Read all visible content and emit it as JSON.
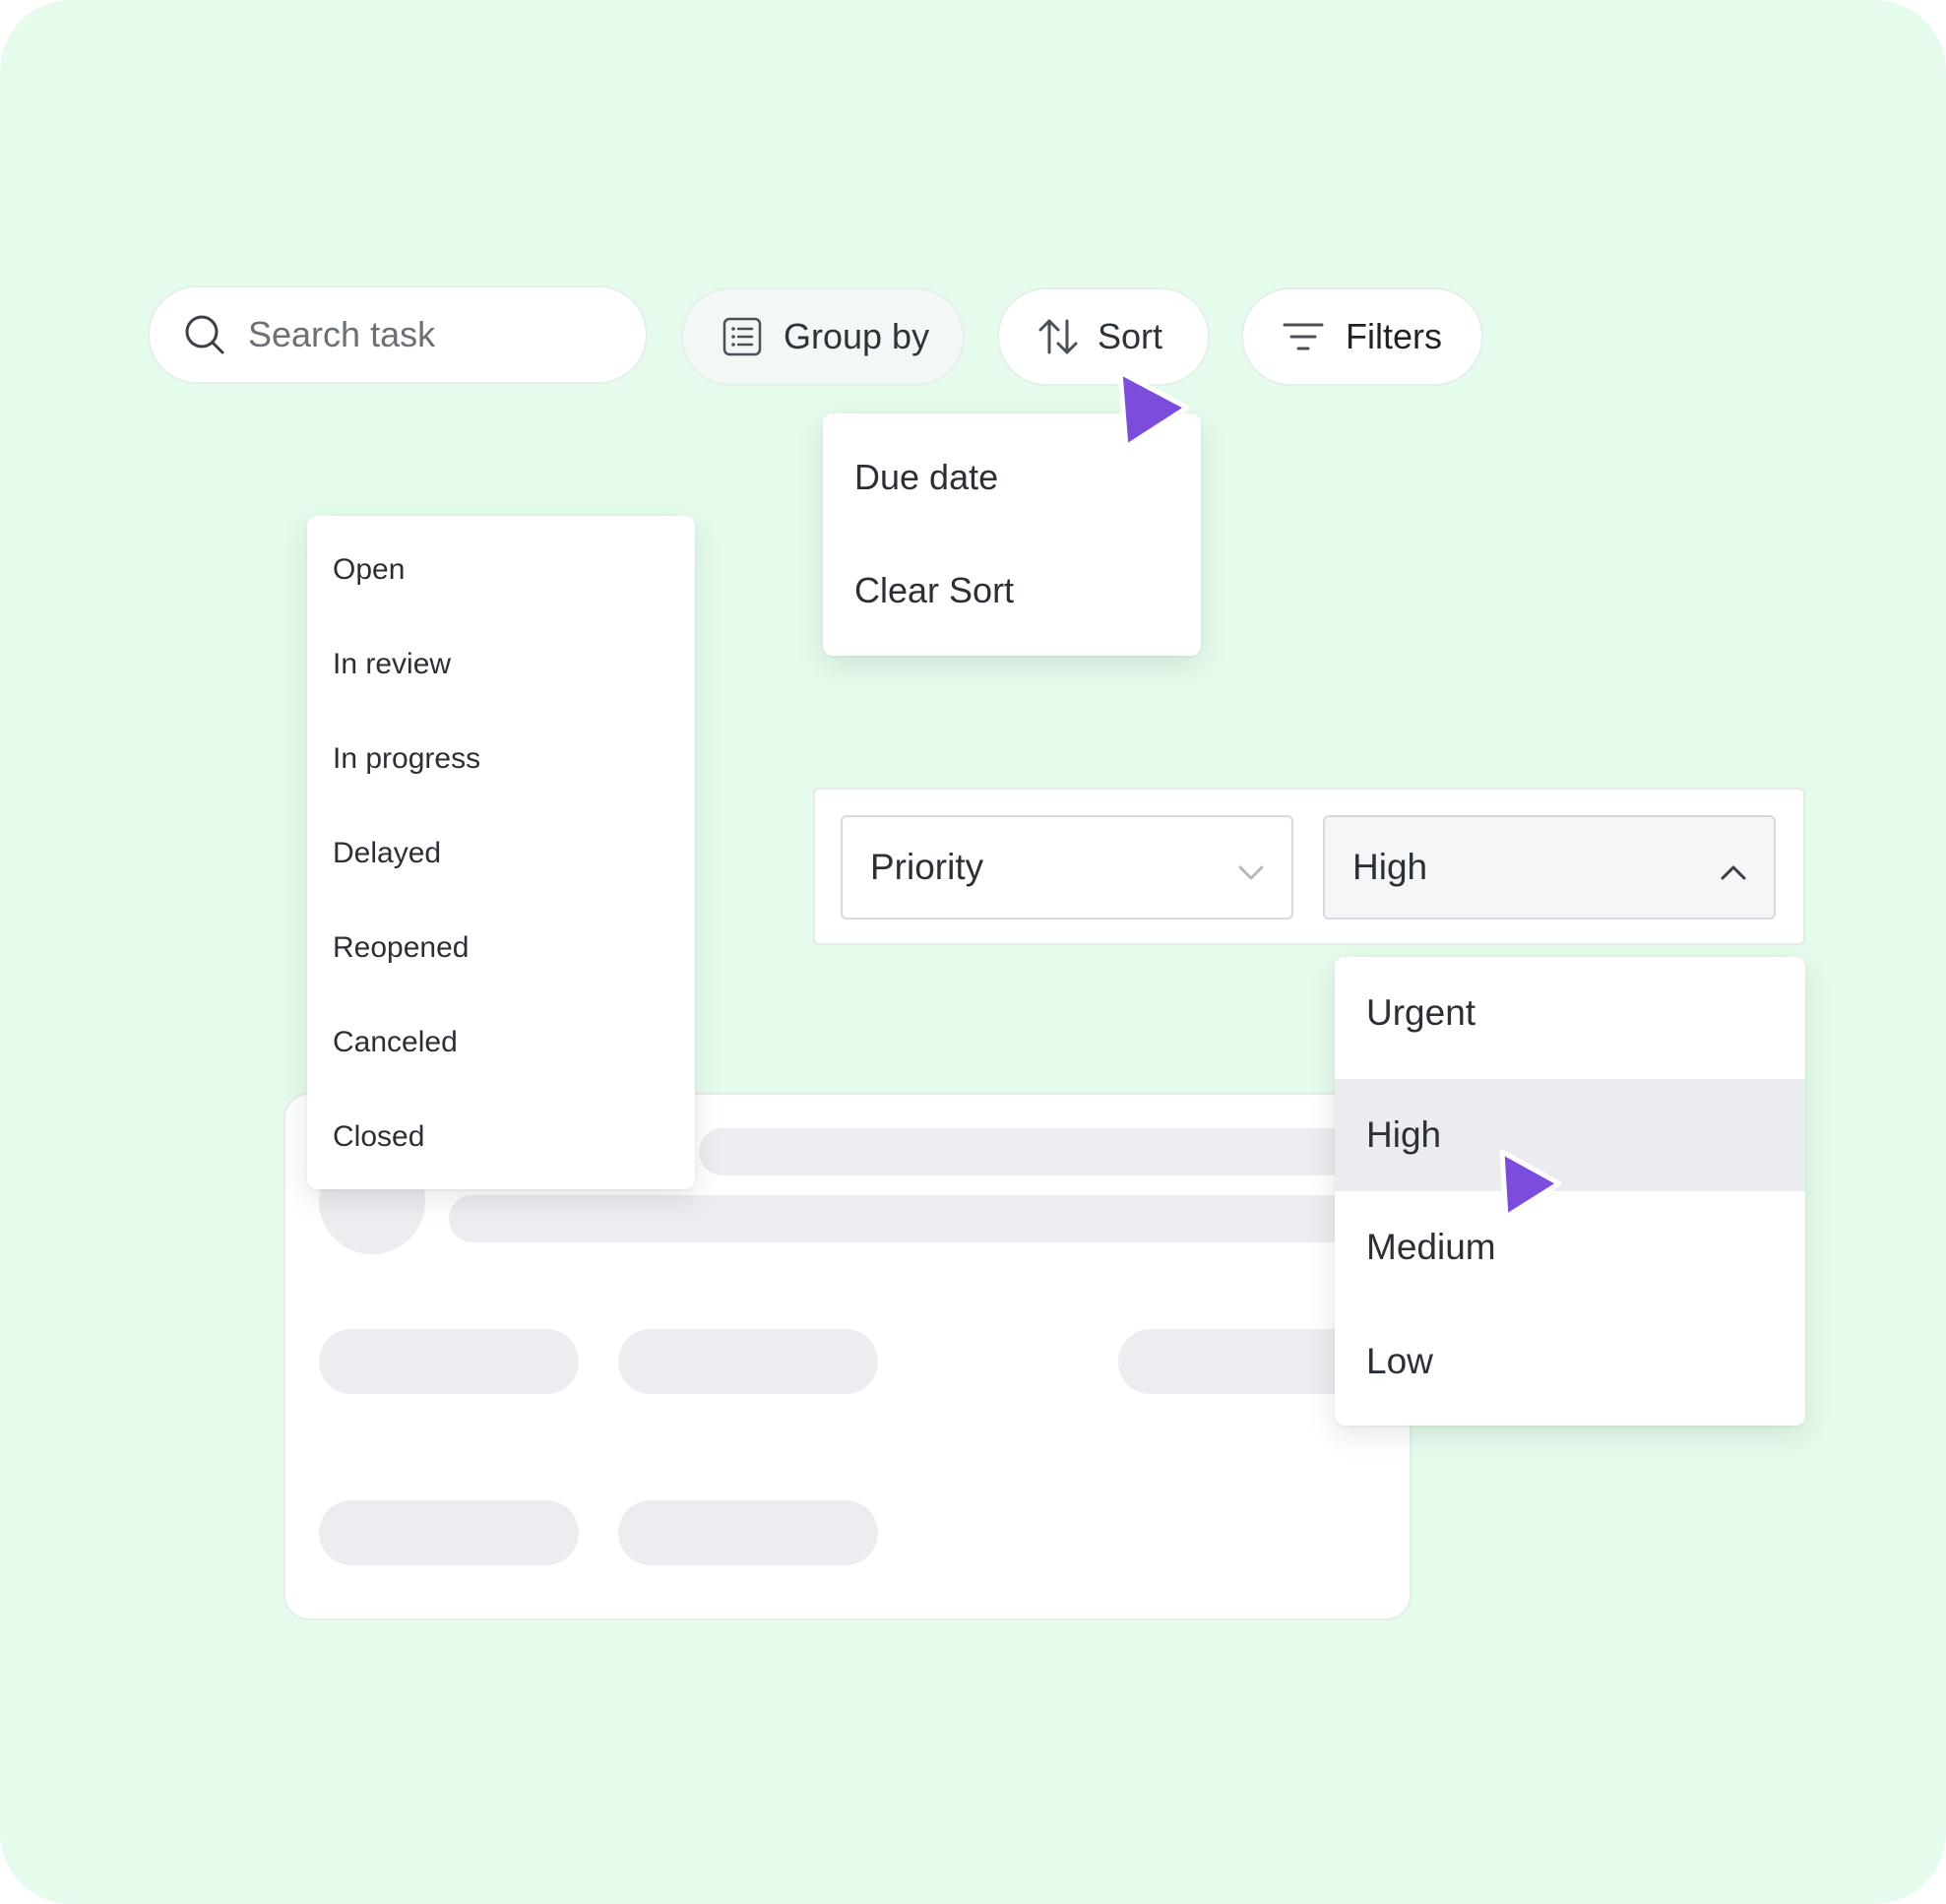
{
  "toolbar": {
    "search_placeholder": "Search task",
    "group_by_label": "Group by",
    "sort_label": "Sort",
    "filters_label": "Filters"
  },
  "sort_menu": {
    "items": [
      "Due date",
      "Clear Sort"
    ]
  },
  "status_menu": {
    "items": [
      "Open",
      "In review",
      "In progress",
      "Delayed",
      "Reopened",
      "Canceled",
      "Closed"
    ]
  },
  "filter": {
    "field_value": "Priority",
    "level_value": "High"
  },
  "priority_menu": {
    "items": [
      "Urgent",
      "High",
      "Medium",
      "Low"
    ],
    "highlighted": "High"
  },
  "colors": {
    "background": "#e5fcec",
    "cursor": "#7c4ddb",
    "skeleton": "#ebedf0"
  }
}
